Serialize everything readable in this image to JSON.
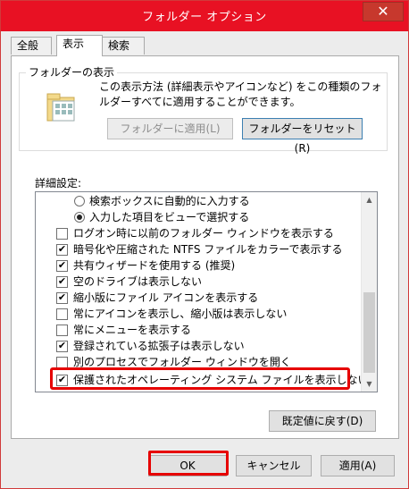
{
  "window": {
    "title": "フォルダー オプション",
    "close_glyph": "✕"
  },
  "tabs": [
    {
      "label": "全般"
    },
    {
      "label": "表示"
    },
    {
      "label": "検索"
    }
  ],
  "folder_view": {
    "group_label": "フォルダーの表示",
    "description": "この表示方法 (詳細表示やアイコンなど) をこの種類のフォルダーすべてに適用することができます。",
    "apply_button": "フォルダーに適用(L)",
    "reset_button": "フォルダーをリセット(R)"
  },
  "advanced": {
    "label": "詳細設定:",
    "items": [
      {
        "type": "radio",
        "checked": false,
        "label": "検索ボックスに自動的に入力する"
      },
      {
        "type": "radio",
        "checked": true,
        "label": "入力した項目をビューで選択する"
      },
      {
        "type": "checkbox",
        "checked": false,
        "label": "ログオン時に以前のフォルダー ウィンドウを表示する"
      },
      {
        "type": "checkbox",
        "checked": true,
        "label": "暗号化や圧縮された NTFS ファイルをカラーで表示する"
      },
      {
        "type": "checkbox",
        "checked": true,
        "label": "共有ウィザードを使用する (推奨)"
      },
      {
        "type": "checkbox",
        "checked": true,
        "label": "空のドライブは表示しない"
      },
      {
        "type": "checkbox",
        "checked": true,
        "label": "縮小版にファイル アイコンを表示する"
      },
      {
        "type": "checkbox",
        "checked": false,
        "label": "常にアイコンを表示し、縮小版は表示しない"
      },
      {
        "type": "checkbox",
        "checked": false,
        "label": "常にメニューを表示する"
      },
      {
        "type": "checkbox",
        "checked": true,
        "label": "登録されている拡張子は表示しない"
      },
      {
        "type": "checkbox",
        "checked": false,
        "label": "別のプロセスでフォルダー ウィンドウを開く"
      },
      {
        "type": "checkbox",
        "checked": true,
        "label": "保護されたオペレーティング システム ファイルを表示しない (推奨)"
      }
    ],
    "restore_default_button": "既定値に戻す(D)"
  },
  "footer": {
    "ok": "OK",
    "cancel": "キャンセル",
    "apply": "適用(A)"
  },
  "colors": {
    "title_bar": "#e81123",
    "highlight": "#e60000"
  }
}
